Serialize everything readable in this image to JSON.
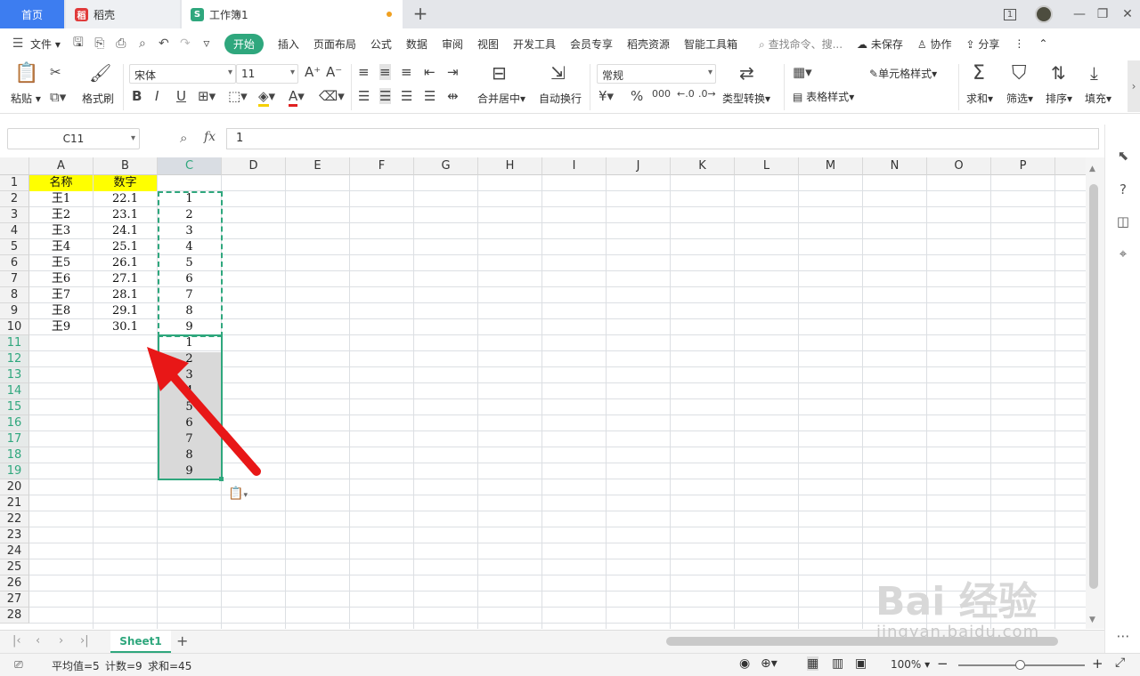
{
  "tabs": {
    "home": "首页",
    "daoke": "稻壳",
    "workbook": "工作簿1",
    "add": "+"
  },
  "window": {
    "badge": "1",
    "minimize": "—",
    "restore": "❐",
    "close": "✕"
  },
  "menu": {
    "file": "文件",
    "items": [
      "开始",
      "插入",
      "页面布局",
      "公式",
      "数据",
      "审阅",
      "视图",
      "开发工具",
      "会员专享",
      "稻壳资源",
      "智能工具箱"
    ],
    "search_placeholder": "查找命令、搜...",
    "unsaved": "未保存",
    "collab": "协作",
    "share": "分享"
  },
  "ribbon": {
    "paste": "粘贴",
    "format_painter": "格式刷",
    "font_name": "宋体",
    "font_size": "11",
    "merge_center": "合并居中",
    "wrap_text": "自动换行",
    "number_format": "常规",
    "type_convert": "类型转换",
    "cond_format": "条件格式",
    "cell_style": "单元格样式",
    "table_style": "表格样式",
    "sum": "求和",
    "filter": "筛选",
    "sort": "排序",
    "fill": "填充",
    "currency": "¥",
    "percent": "%",
    "thousands": "000"
  },
  "formula_bar": {
    "cell_ref": "C11",
    "fx": "fx",
    "value": "1"
  },
  "columns": [
    "A",
    "B",
    "C",
    "D",
    "E",
    "F",
    "G",
    "H",
    "I",
    "J",
    "K",
    "L",
    "M",
    "N",
    "O",
    "P"
  ],
  "rows": [
    "1",
    "2",
    "3",
    "4",
    "5",
    "6",
    "7",
    "8",
    "9",
    "10",
    "11",
    "12",
    "13",
    "14",
    "15",
    "16",
    "17",
    "18",
    "19",
    "20",
    "21",
    "22",
    "23",
    "24",
    "25",
    "26",
    "27",
    "28"
  ],
  "cells": {
    "A1": "名称",
    "B1": "数字",
    "A2": "王1",
    "B2": "22.1",
    "C2": "1",
    "A3": "王2",
    "B3": "23.1",
    "C3": "2",
    "A4": "王3",
    "B4": "24.1",
    "C4": "3",
    "A5": "王4",
    "B5": "25.1",
    "C5": "4",
    "A6": "王5",
    "B6": "26.1",
    "C6": "5",
    "A7": "王6",
    "B7": "27.1",
    "C7": "6",
    "A8": "王7",
    "B8": "28.1",
    "C8": "7",
    "A9": "王8",
    "B9": "29.1",
    "C9": "8",
    "A10": "王9",
    "B10": "30.1",
    "C10": "9",
    "C11": "1",
    "C12": "2",
    "C13": "3",
    "C14": "4",
    "C15": "5",
    "C16": "6",
    "C17": "7",
    "C18": "8",
    "C19": "9"
  },
  "sheet": {
    "name": "Sheet1",
    "add": "+"
  },
  "status": {
    "average": "平均值=5",
    "count": "计数=9",
    "sum": "求和=45",
    "zoom": "100%"
  },
  "watermark": {
    "brand": "Bai 经验",
    "url": "jingyan.baidu.com"
  },
  "colors": {
    "accent": "#2fa77d",
    "header_yellow": "#ffff00",
    "arrow": "#e81717",
    "tab_blue": "#3d7df0"
  }
}
